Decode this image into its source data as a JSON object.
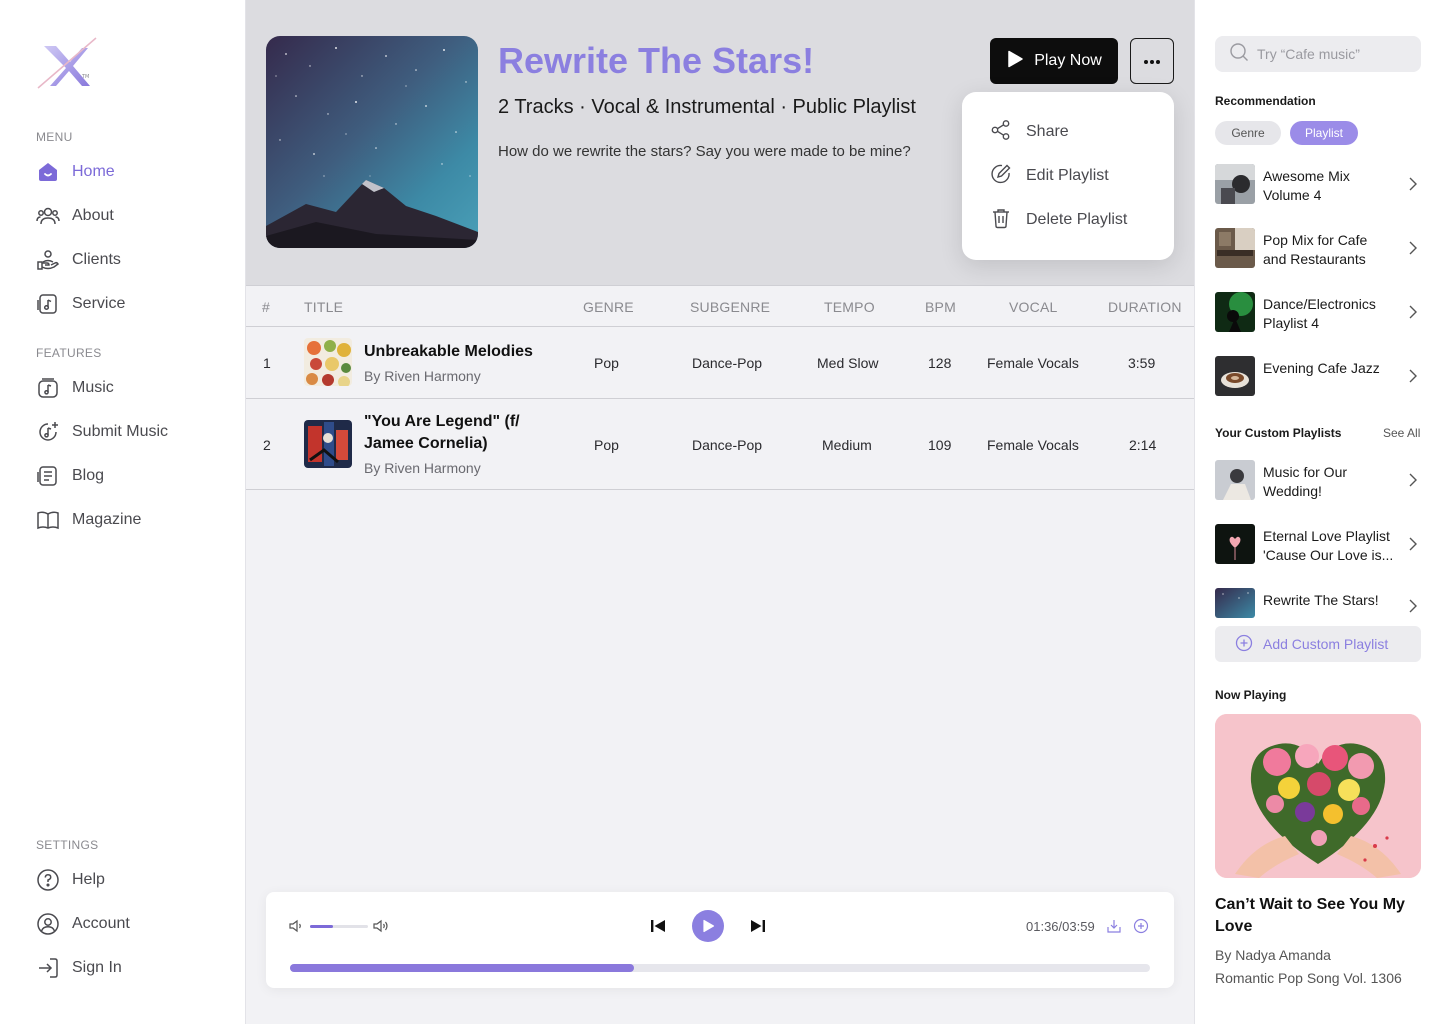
{
  "colors": {
    "accent": "#8b7fe0",
    "accent_dark": "#7c6ad8",
    "play_button_bg": "#0d0d0d"
  },
  "sidebar": {
    "menu_label": "MENU",
    "features_label": "FEATURES",
    "settings_label": "SETTINGS",
    "menu_items": [
      {
        "label": "Home",
        "icon": "home-icon",
        "active": true
      },
      {
        "label": "About",
        "icon": "people-icon"
      },
      {
        "label": "Clients",
        "icon": "handshake-icon"
      },
      {
        "label": "Service",
        "icon": "music-file-icon"
      }
    ],
    "feature_items": [
      {
        "label": "Music",
        "icon": "music-box-icon"
      },
      {
        "label": "Submit Music",
        "icon": "submit-music-icon"
      },
      {
        "label": "Blog",
        "icon": "blog-icon"
      },
      {
        "label": "Magazine",
        "icon": "book-icon"
      }
    ],
    "settings_items": [
      {
        "label": "Help",
        "icon": "help-icon"
      },
      {
        "label": "Account",
        "icon": "account-icon"
      },
      {
        "label": "Sign In",
        "icon": "sign-in-icon"
      }
    ]
  },
  "playlist": {
    "title": "Rewrite The Stars!",
    "meta": "2 Tracks · Vocal & Instrumental · Public Playlist",
    "description": "How do we rewrite the stars? Say you were made to be mine?",
    "play_label": "Play Now",
    "menu": [
      {
        "label": "Share",
        "icon": "share-icon"
      },
      {
        "label": "Edit Playlist",
        "icon": "edit-icon"
      },
      {
        "label": "Delete Playlist",
        "icon": "trash-icon"
      }
    ]
  },
  "table": {
    "headers": {
      "num": "#",
      "title": "TITLE",
      "genre": "GENRE",
      "subgenre": "SUBGENRE",
      "tempo": "TEMPO",
      "bpm": "BPM",
      "vocal": "VOCAL",
      "duration": "DURATION"
    },
    "rows": [
      {
        "num": "1",
        "title": "Unbreakable Melodies",
        "artist": "By Riven Harmony",
        "genre": "Pop",
        "subgenre": "Dance-Pop",
        "tempo": "Med Slow",
        "bpm": "128",
        "vocal": "Female Vocals",
        "duration": "3:59"
      },
      {
        "num": "2",
        "title_line1": "\"You Are Legend\" (f/",
        "title_line2": "Jamee Cornelia)",
        "artist": "By Riven Harmony",
        "genre": "Pop",
        "subgenre": "Dance-Pop",
        "tempo": "Medium",
        "bpm": "109",
        "vocal": "Female Vocals",
        "duration": "2:14"
      }
    ]
  },
  "player": {
    "time": "01:36/03:59",
    "volume_fraction": 0.4,
    "progress_fraction": 0.4
  },
  "right": {
    "search_placeholder": "Try “Cafe music”",
    "recommendation_heading": "Recommendation",
    "pills": {
      "genre": "Genre",
      "playlist": "Playlist"
    },
    "recommendations": [
      {
        "line1": "Awesome Mix",
        "line2": "Volume 4"
      },
      {
        "line1": "Pop Mix for Cafe",
        "line2": "and Restaurants"
      },
      {
        "line1": "Dance/Electronics",
        "line2": "Playlist 4"
      },
      {
        "line1": "Evening Cafe Jazz",
        "line2": ""
      }
    ],
    "custom_heading": "Your Custom Playlists",
    "see_all": "See All",
    "custom": [
      {
        "line1": "Music for Our",
        "line2": "Wedding!"
      },
      {
        "line1": "Eternal Love Playlist",
        "line2": "'Cause Our Love is..."
      },
      {
        "line1": "Rewrite The Stars!",
        "line2": ""
      }
    ],
    "add_custom": "Add Custom Playlist",
    "now_playing_heading": "Now Playing",
    "now_playing": {
      "title": "Can’t Wait to See You My Love",
      "artist": "By Nadya Amanda",
      "album": "Romantic Pop Song Vol. 1306"
    }
  }
}
